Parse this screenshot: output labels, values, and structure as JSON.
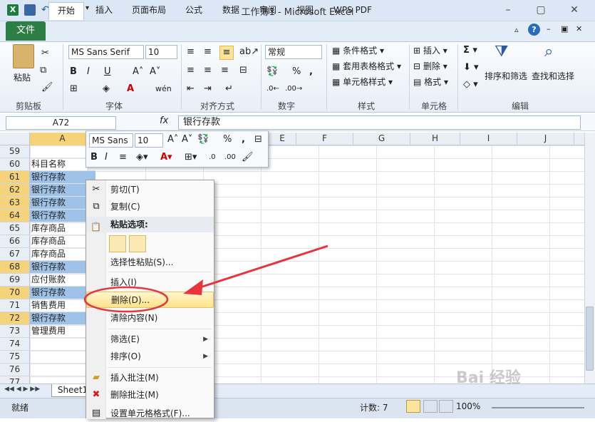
{
  "window": {
    "title": "工作簿1 - Microsoft Excel"
  },
  "tabs": [
    "开始",
    "插入",
    "页面布局",
    "公式",
    "数据",
    "审阅",
    "视图",
    "WPS PDF"
  ],
  "file_tab": "文件",
  "ribbon": {
    "paste_label": "粘贴",
    "font_name": "MS Sans Serif",
    "font_size": "10",
    "number_format": "常规",
    "style_items": [
      "条件格式",
      "套用表格格式",
      "单元格样式"
    ],
    "cell_items": [
      "插入",
      "删除",
      "格式"
    ],
    "sort_label": "排序和筛选",
    "find_label": "查找和选择",
    "groups": [
      "剪贴板",
      "字体",
      "对齐方式",
      "数字",
      "样式",
      "单元格",
      "编辑"
    ]
  },
  "formula_bar": {
    "name_box": "A72",
    "fx": "fx",
    "value": "银行存款"
  },
  "columns": [
    "A",
    "E",
    "F",
    "G",
    "H",
    "I",
    "J"
  ],
  "rows": [
    {
      "num": "59",
      "a": "",
      "sel": false
    },
    {
      "num": "60",
      "a": "科目名称",
      "sel": false
    },
    {
      "num": "61",
      "a": "银行存款",
      "sel": true
    },
    {
      "num": "62",
      "a": "银行存款",
      "sel": true
    },
    {
      "num": "63",
      "a": "银行存款",
      "sel": true
    },
    {
      "num": "64",
      "a": "银行存款",
      "sel": true
    },
    {
      "num": "65",
      "a": "库存商品",
      "sel": false
    },
    {
      "num": "66",
      "a": "库存商品",
      "sel": false
    },
    {
      "num": "67",
      "a": "库存商品",
      "sel": false
    },
    {
      "num": "68",
      "a": "银行存款",
      "sel": true
    },
    {
      "num": "69",
      "a": "应付账款",
      "sel": false
    },
    {
      "num": "70",
      "a": "银行存款",
      "sel": true
    },
    {
      "num": "71",
      "a": "销售费用",
      "sel": false
    },
    {
      "num": "72",
      "a": "银行存款",
      "sel": true
    },
    {
      "num": "73",
      "a": "管理费用",
      "sel": false
    },
    {
      "num": "74",
      "a": "",
      "sel": false
    },
    {
      "num": "75",
      "a": "",
      "sel": false
    },
    {
      "num": "76",
      "a": "",
      "sel": false
    },
    {
      "num": "77",
      "a": "",
      "sel": false
    }
  ],
  "mini_toolbar": {
    "font": "MS Sans",
    "size": "10"
  },
  "context_menu": {
    "cut": "剪切(T)",
    "copy": "复制(C)",
    "paste_options": "粘贴选项:",
    "paste_special": "选择性粘贴(S)...",
    "insert": "插入(I)",
    "delete": "删除(D)...",
    "clear": "清除内容(N)",
    "filter": "筛选(E)",
    "sort": "排序(O)",
    "insert_comment": "插入批注(M)",
    "delete_comment": "删除批注(M)",
    "format_cells": "设置单元格格式(F)..."
  },
  "sheet_tab": "Sheet1",
  "status": {
    "ready": "就绪",
    "count": "计数: 7",
    "zoom": "100%"
  },
  "watermark": "Bai 经验",
  "colors": {
    "accent": "#2d7d46",
    "selection": "#9fc2e8",
    "annotation": "#e8353c"
  }
}
